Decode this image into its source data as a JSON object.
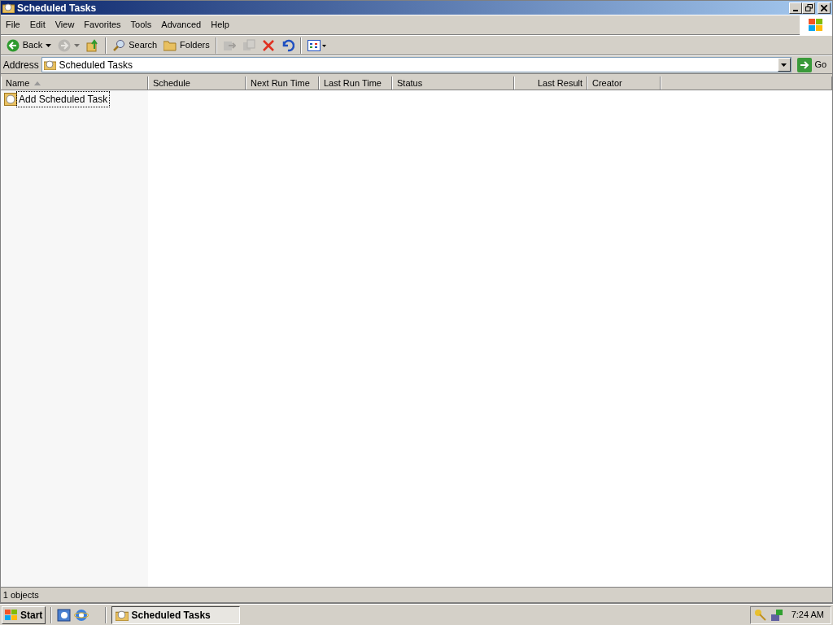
{
  "window": {
    "title": "Scheduled Tasks"
  },
  "menu": [
    {
      "label": "File"
    },
    {
      "label": "Edit"
    },
    {
      "label": "View"
    },
    {
      "label": "Favorites"
    },
    {
      "label": "Tools"
    },
    {
      "label": "Advanced"
    },
    {
      "label": "Help"
    }
  ],
  "toolbar": [
    {
      "kind": "back",
      "label": "Back",
      "disabled": false
    },
    {
      "kind": "forward",
      "disabled": true
    },
    {
      "kind": "up",
      "disabled": false
    },
    {
      "kind": "sep"
    },
    {
      "kind": "search",
      "label": "Search",
      "disabled": false
    },
    {
      "kind": "folders",
      "label": "Folders",
      "disabled": false
    },
    {
      "kind": "sep"
    },
    {
      "kind": "moveto",
      "disabled": true
    },
    {
      "kind": "copyto",
      "disabled": true
    },
    {
      "kind": "delete",
      "disabled": false
    },
    {
      "kind": "undo",
      "disabled": false
    },
    {
      "kind": "sep"
    },
    {
      "kind": "views",
      "disabled": false
    }
  ],
  "address": {
    "label": "Address",
    "value": "Scheduled Tasks",
    "go": "Go"
  },
  "table": {
    "columns": [
      {
        "label": "Name",
        "sorted": true
      },
      {
        "label": "Schedule",
        "sorted": false
      },
      {
        "label": "Next Run Time",
        "sorted": false
      },
      {
        "label": "Last Run Time",
        "sorted": false
      },
      {
        "label": "Status",
        "sorted": false
      },
      {
        "label": "Last Result",
        "sorted": false
      },
      {
        "label": "Creator",
        "sorted": false
      }
    ],
    "rows": [
      {
        "name": "Add Scheduled Task",
        "selected": false,
        "focused": true
      }
    ]
  },
  "status_bar": {
    "text": "1 objects"
  },
  "taskbar": {
    "start": "Start",
    "quick_launch": [
      {
        "kind": "desktop"
      },
      {
        "kind": "ie"
      }
    ],
    "tasks": [
      {
        "label": "Scheduled Tasks",
        "selected": true
      }
    ],
    "clock": "7:24 AM"
  }
}
